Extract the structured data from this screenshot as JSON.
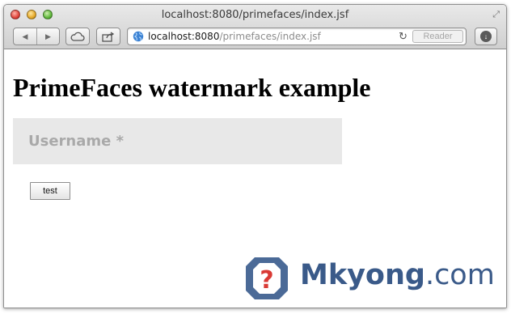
{
  "window": {
    "title": "localhost:8080/primefaces/index.jsf"
  },
  "toolbar": {
    "url_host": "localhost:8080",
    "url_path": "/primefaces/index.jsf",
    "reader_label": "Reader",
    "icons": {
      "back": "back-arrow-icon",
      "forward": "forward-arrow-icon",
      "cloud": "cloud-icon",
      "share": "share-icon",
      "globe": "globe-icon",
      "reload": "reload-icon",
      "download": "download-icon"
    }
  },
  "page": {
    "heading": "PrimeFaces watermark example",
    "username_placeholder": "Username *",
    "username_value": "",
    "test_button_label": "test"
  },
  "watermark": {
    "brand": "Mkyong",
    "tld": ".com",
    "color": "#3a5a89",
    "accent_color": "#d93a35"
  }
}
